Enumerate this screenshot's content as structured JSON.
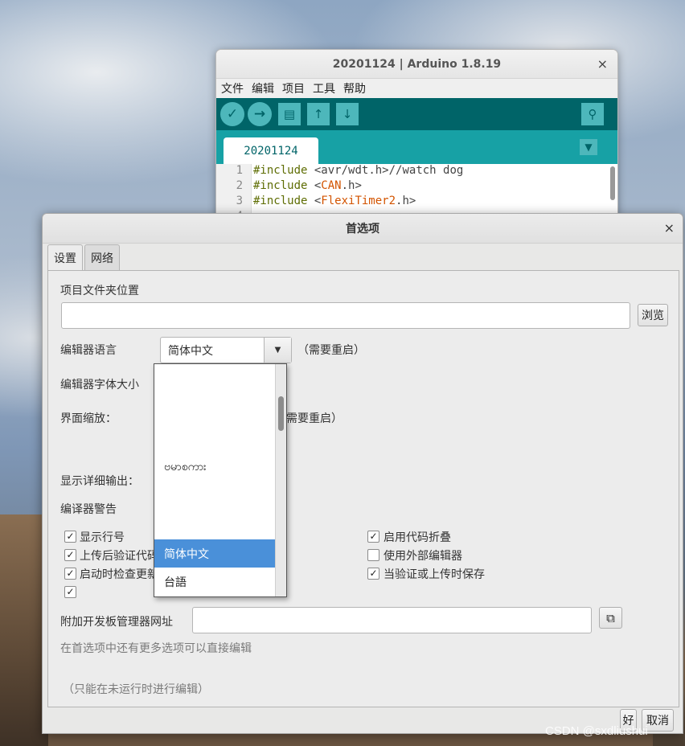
{
  "arduino": {
    "title": "20201124 | Arduino 1.8.19",
    "close": "×",
    "menu": [
      "文件",
      "编辑",
      "项目",
      "工具",
      "帮助"
    ],
    "toolbar": {
      "verify": "✓",
      "upload": "→",
      "new": "▤",
      "open": "↑",
      "save": "↓",
      "serial_monitor": "⚲"
    },
    "tab": "20201124",
    "tab_menu": "▼",
    "code": [
      {
        "no": "1",
        "kw": "#include",
        "pre": " <",
        "lib": "avr/wdt",
        "post": ".h>//watch dog"
      },
      {
        "no": "2",
        "kw": "#include",
        "pre": " <",
        "lib": "CAN",
        "post": ".h>"
      },
      {
        "no": "3",
        "kw": "#include",
        "pre": " <",
        "lib": "FlexiTimer2",
        "post": ".h>"
      },
      {
        "no": "4",
        "kw": "",
        "pre": "",
        "lib": "",
        "post": ""
      }
    ]
  },
  "prefs": {
    "title": "首选项",
    "close": "×",
    "tabs": [
      "设置",
      "网络"
    ],
    "sketchbook_label": "项目文件夹位置",
    "sketchbook_value": "",
    "browse": "浏览",
    "editor_language_label": "编辑器语言",
    "editor_language_value": "简体中文",
    "combo_arrow": "▼",
    "restart_note1": "（需要重启）",
    "font_size_label": "编辑器字体大小",
    "scale_label": "界面缩放：",
    "restart_note2": "需要重启）",
    "verbose_label": "显示详细输出：",
    "warnings_label": "编译器警告",
    "checkboxes_left": [
      {
        "label": "显示行号",
        "checked": "✓"
      },
      {
        "label": "上传后验证代码",
        "checked": "✓"
      },
      {
        "label": "启动时检查更新",
        "checked": "✓"
      },
      {
        "label": "",
        "checked": "✓"
      }
    ],
    "checkboxes_right": [
      {
        "label": "启用代码折叠",
        "checked": "✓"
      },
      {
        "label": "使用外部编辑器",
        "checked": ""
      },
      {
        "label": "当验证或上传时保存",
        "checked": "✓"
      }
    ],
    "boards_url_label": "附加开发板管理器网址",
    "boards_url_value": "",
    "more_prefs_hint": "在首选项中还有更多选项可以直接编辑",
    "edit_note": "（只能在未运行时进行编辑）",
    "ok": "好",
    "cancel": "取消"
  },
  "dropdown": {
    "items": [
      "ဗမာစကား",
      "简体中文",
      "台語"
    ],
    "selected": "简体中文"
  },
  "watermark": "CSDN @sxdliushui"
}
